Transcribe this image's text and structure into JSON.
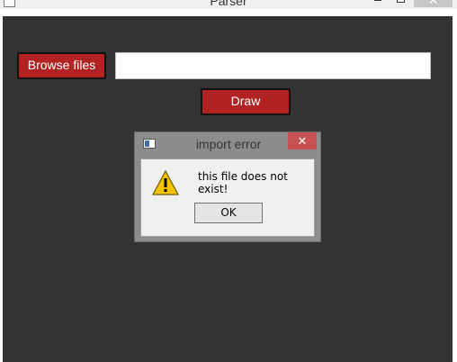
{
  "window": {
    "title": "Parser",
    "close_glyph": "✕"
  },
  "main": {
    "browse_label": "Browse files",
    "file_path_value": "",
    "file_path_placeholder": "",
    "draw_label": "Draw",
    "background_color": "#333333",
    "button_color": "#b22222"
  },
  "dialog": {
    "title": "import error",
    "close_glyph": "✕",
    "message": "this file does not exist!",
    "ok_label": "OK",
    "icon": "warning-icon",
    "close_color": "#c75050"
  }
}
